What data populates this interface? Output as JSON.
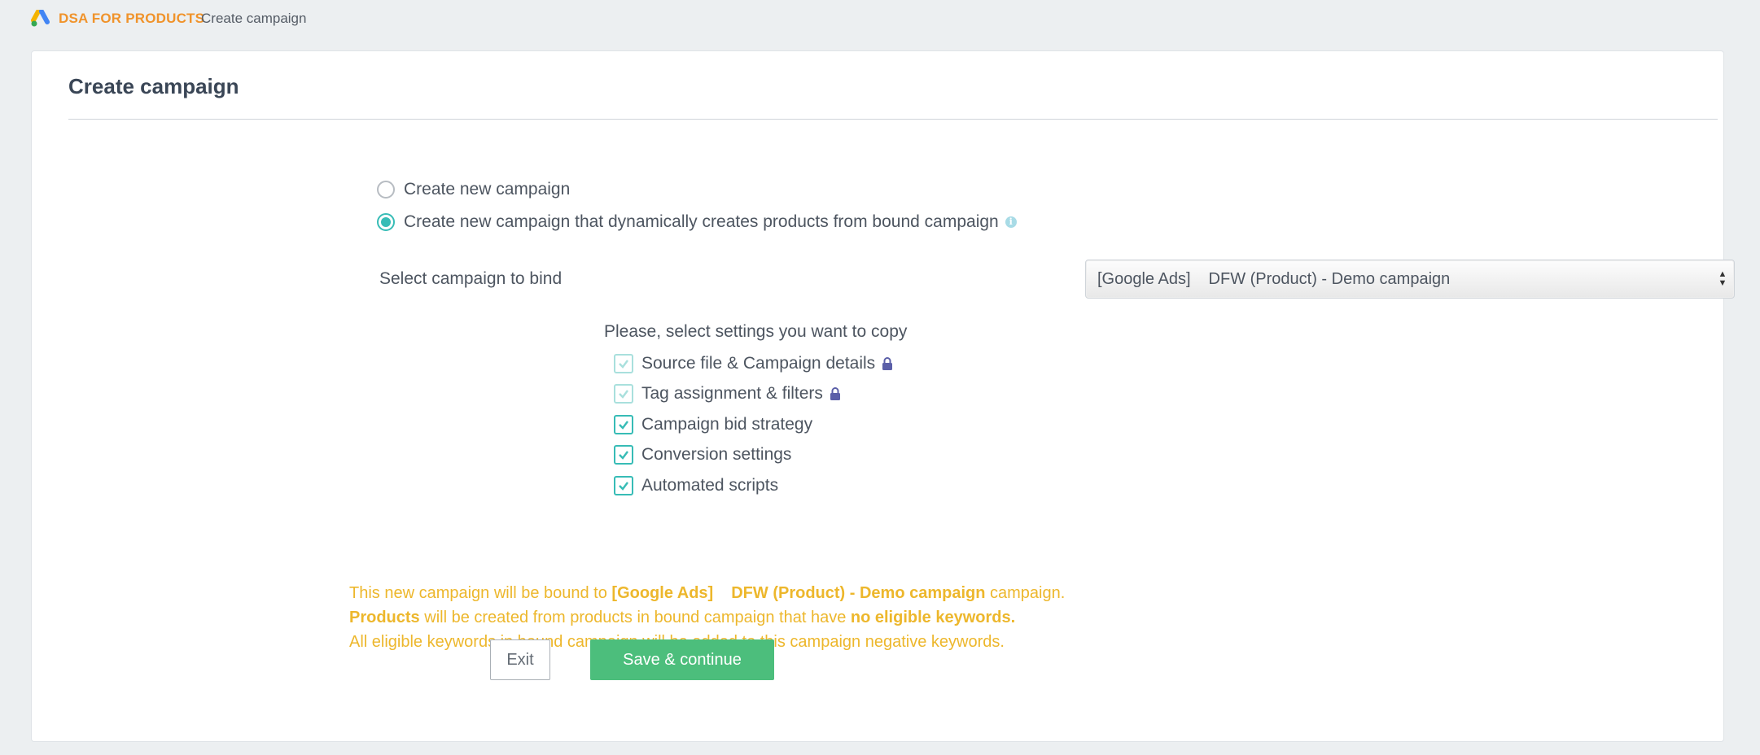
{
  "header": {
    "brand": "DSA FOR PRODUCTS",
    "breadcrumb": "Create campaign"
  },
  "card": {
    "title": "Create campaign"
  },
  "campaign_type": {
    "options": [
      {
        "label": "Create new campaign",
        "selected": false
      },
      {
        "label": "Create new campaign that dynamically creates products from bound campaign",
        "selected": true
      }
    ],
    "info_icon": "info-icon"
  },
  "bind": {
    "label": "Select campaign to bind",
    "selected_platform": "[Google Ads]",
    "selected_campaign": "DFW (Product) - Demo campaign"
  },
  "copy_settings": {
    "heading": "Please, select settings you want to copy",
    "items": [
      {
        "label": "Source file & Campaign details",
        "checked": true,
        "locked": true
      },
      {
        "label": "Tag assignment & filters",
        "checked": true,
        "locked": true
      },
      {
        "label": "Campaign bid strategy",
        "checked": true,
        "locked": false
      },
      {
        "label": "Conversion settings",
        "checked": true,
        "locked": false
      },
      {
        "label": "Automated scripts",
        "checked": true,
        "locked": false
      }
    ]
  },
  "notice": {
    "line1_pre": "This new campaign will be bound to ",
    "line1_platform": "[Google Ads]",
    "line1_campaign": "DFW (Product) - Demo campaign",
    "line1_post": " campaign.",
    "line2_bold1": "Products",
    "line2_mid": " will be created from products in bound campaign that have ",
    "line2_bold2": "no eligible keywords.",
    "line3": "All eligible keywords in bound campaign will be added to this campaign negative keywords."
  },
  "buttons": {
    "exit": "Exit",
    "save": "Save & continue"
  },
  "colors": {
    "accent": "#37bcb6",
    "brand": "#f0932b",
    "notice": "#edb72c",
    "save": "#4cbe7c"
  }
}
